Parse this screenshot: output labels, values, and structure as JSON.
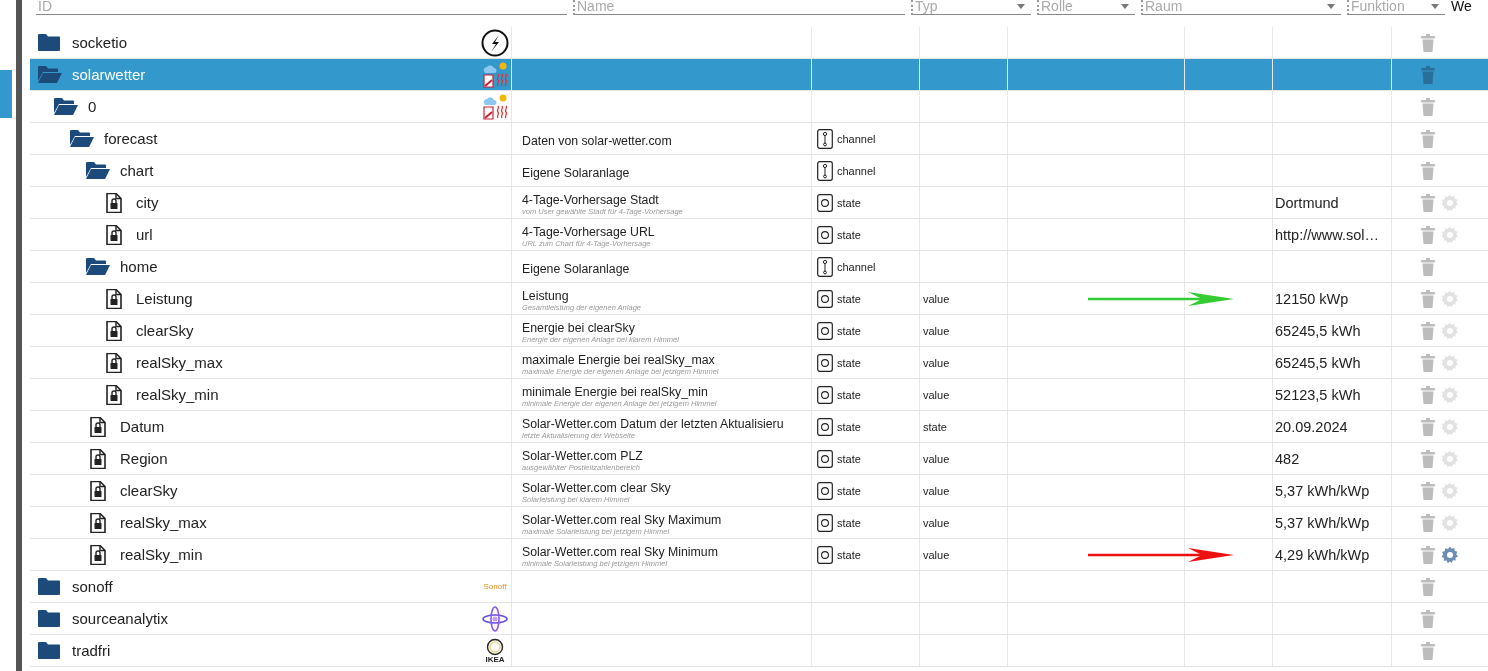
{
  "filters": [
    {
      "label": "ID",
      "kind": "text"
    },
    {
      "label": "Name",
      "kind": "text"
    },
    {
      "label": "Typ",
      "kind": "select"
    },
    {
      "label": "Rolle",
      "kind": "select"
    },
    {
      "label": "Raum",
      "kind": "select"
    },
    {
      "label": "Funktion",
      "kind": "select"
    },
    {
      "label": "We",
      "kind": "column"
    }
  ],
  "tree": [
    {
      "name": "socketio",
      "kind": "folder",
      "expanded": false,
      "selected": false,
      "logo": {
        "kind": "lightning"
      }
    },
    {
      "name": "solarwetter",
      "kind": "folder",
      "expanded": true,
      "selected": true,
      "logo": {
        "kind": "weather"
      },
      "children": [
        {
          "name": "0",
          "kind": "folder",
          "expanded": true,
          "selected": false,
          "logo": {
            "kind": "weather"
          },
          "children": [
            {
              "name": "forecast",
              "kind": "folder",
              "expanded": true,
              "selected": false,
              "title": "Daten von solar-wetter.com",
              "type": {
                "kind": "channel",
                "label": "channel"
              },
              "children": [
                {
                  "name": "chart",
                  "kind": "folder",
                  "expanded": true,
                  "selected": false,
                  "title": "Eigene Solaranlage",
                  "type": {
                    "kind": "channel",
                    "label": "channel"
                  },
                  "children": [
                    {
                      "name": "city",
                      "kind": "state",
                      "selected": false,
                      "title": "4-Tage-Vorhersage Stadt",
                      "subtitle": "vom User gewählte Stadt für 4-Tage-Vorhersage",
                      "type": {
                        "kind": "state",
                        "label": "state"
                      },
                      "value": "Dortmund",
                      "gear_active": false
                    },
                    {
                      "name": "url",
                      "kind": "state",
                      "selected": false,
                      "title": "4-Tage-Vorhersage URL",
                      "subtitle": "URL zum Chart für 4-Tage-Vorhersage",
                      "type": {
                        "kind": "state",
                        "label": "state"
                      },
                      "value": "http://www.sol…",
                      "gear_active": false
                    }
                  ]
                },
                {
                  "name": "home",
                  "kind": "folder",
                  "expanded": true,
                  "selected": false,
                  "title": "Eigene Solaranlage",
                  "type": {
                    "kind": "channel",
                    "label": "channel"
                  },
                  "children": [
                    {
                      "name": "Leistung",
                      "kind": "state",
                      "selected": false,
                      "title": "Leistung",
                      "subtitle": "Gesamtleistung der eigenen Anlage",
                      "type": {
                        "kind": "state",
                        "label": "state"
                      },
                      "role": "value",
                      "value": "12150 kWp",
                      "gear_active": false,
                      "arrow": {
                        "color": "#33cc33"
                      }
                    },
                    {
                      "name": "clearSky",
                      "kind": "state",
                      "selected": false,
                      "title": "Energie bei clearSky",
                      "subtitle": "Energie der eigenen Anlage bei klarem Himmel",
                      "type": {
                        "kind": "state",
                        "label": "state"
                      },
                      "role": "value",
                      "value": "65245,5 kWh",
                      "gear_active": false
                    },
                    {
                      "name": "realSky_max",
                      "kind": "state",
                      "selected": false,
                      "title": "maximale Energie bei realSky_max",
                      "subtitle": "maximale Energie der eigenen Anlage bei jetzigem Himmel",
                      "type": {
                        "kind": "state",
                        "label": "state"
                      },
                      "role": "value",
                      "value": "65245,5 kWh",
                      "gear_active": false
                    },
                    {
                      "name": "realSky_min",
                      "kind": "state",
                      "selected": false,
                      "title": "minimale Energie bei realSky_min",
                      "subtitle": "minimale Energie der eigenen Anlage bei jetzigem Himmel",
                      "type": {
                        "kind": "state",
                        "label": "state"
                      },
                      "role": "value",
                      "value": "52123,5 kWh",
                      "gear_active": false
                    }
                  ]
                },
                {
                  "name": "Datum",
                  "kind": "state",
                  "selected": false,
                  "title": "Solar-Wetter.com Datum der letzten Aktualisieru",
                  "subtitle": "letzte Aktualisierung der Webseite",
                  "type": {
                    "kind": "state",
                    "label": "state"
                  },
                  "role": "state",
                  "value": "20.09.2024",
                  "gear_active": false
                },
                {
                  "name": "Region",
                  "kind": "state",
                  "selected": false,
                  "title": "Solar-Wetter.com PLZ",
                  "subtitle": "ausgewählter Postleitzahlenbereich",
                  "type": {
                    "kind": "state",
                    "label": "state"
                  },
                  "role": "value",
                  "value": "482",
                  "gear_active": false
                },
                {
                  "name": "clearSky",
                  "kind": "state",
                  "selected": false,
                  "title": "Solar-Wetter.com clear Sky",
                  "subtitle": "Solarleistung bei klarem Himmel",
                  "type": {
                    "kind": "state",
                    "label": "state"
                  },
                  "role": "value",
                  "value": "5,37 kWh/kWp",
                  "gear_active": false
                },
                {
                  "name": "realSky_max",
                  "kind": "state",
                  "selected": false,
                  "title": "Solar-Wetter.com real Sky Maximum",
                  "subtitle": "maximale Solarleistung bei jetzigem Himmel",
                  "type": {
                    "kind": "state",
                    "label": "state"
                  },
                  "role": "value",
                  "value": "5,37 kWh/kWp",
                  "gear_active": false
                },
                {
                  "name": "realSky_min",
                  "kind": "state",
                  "selected": false,
                  "title": "Solar-Wetter.com real Sky Minimum",
                  "subtitle": "minimale Solarleistung bei jetzigem Himmel",
                  "type": {
                    "kind": "state",
                    "label": "state"
                  },
                  "role": "value",
                  "value": "4,29 kWh/kWp",
                  "gear_active": true,
                  "arrow": {
                    "color": "#ee1111"
                  }
                }
              ]
            }
          ]
        }
      ]
    },
    {
      "name": "sonoff",
      "kind": "folder",
      "expanded": false,
      "selected": false,
      "logo": {
        "kind": "wordmark",
        "text": "Sonoff"
      }
    },
    {
      "name": "sourceanalytix",
      "kind": "folder",
      "expanded": false,
      "selected": false,
      "logo": {
        "kind": "atom"
      }
    },
    {
      "name": "tradfri",
      "kind": "folder",
      "expanded": false,
      "selected": false,
      "logo": {
        "kind": "ring",
        "text": "IKEA"
      }
    }
  ]
}
